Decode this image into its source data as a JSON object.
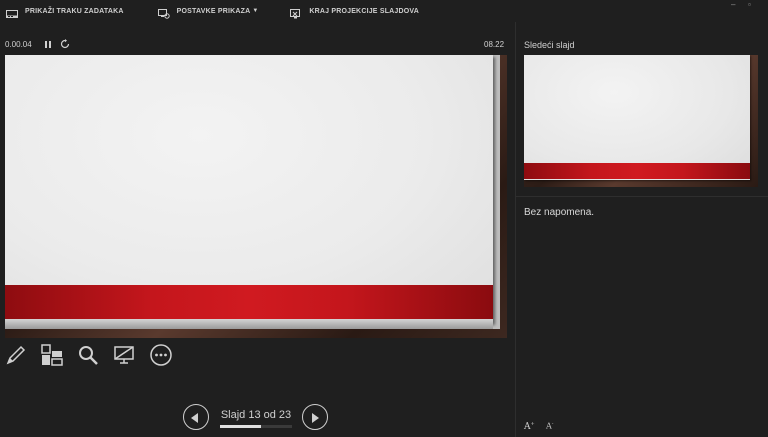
{
  "toolbar": {
    "taskbar_label": "PRIKAŽI TRAKU ZADATAKA",
    "display_settings_label": "POSTAVKE PRIKAZA",
    "end_show_label": "KRAJ PROJEKCIJE SLAJDOVA"
  },
  "presenter": {
    "elapsed_time": "0.00.04",
    "clock": "08.22"
  },
  "navigation": {
    "slide_counter": "Slajd 13 od 23",
    "current_slide": 13,
    "total_slides": 23
  },
  "next_slide": {
    "label": "Sledeći slajd"
  },
  "notes": {
    "text": "Bez napomena."
  },
  "icons": {
    "taskbar": "taskbar-icon",
    "display_settings": "display-settings-icon",
    "end_show": "end-show-icon",
    "pen": "pen-icon",
    "see_all_slides": "see-all-slides-icon",
    "zoom": "magnifier-icon",
    "black_screen": "black-screen-icon",
    "more_options": "more-options-icon",
    "previous": "previous-arrow-icon",
    "next": "next-arrow-icon"
  },
  "colors": {
    "background": "#1f1f1f",
    "slide_accent_red": "#c4161c",
    "text": "#d9d9d9"
  }
}
